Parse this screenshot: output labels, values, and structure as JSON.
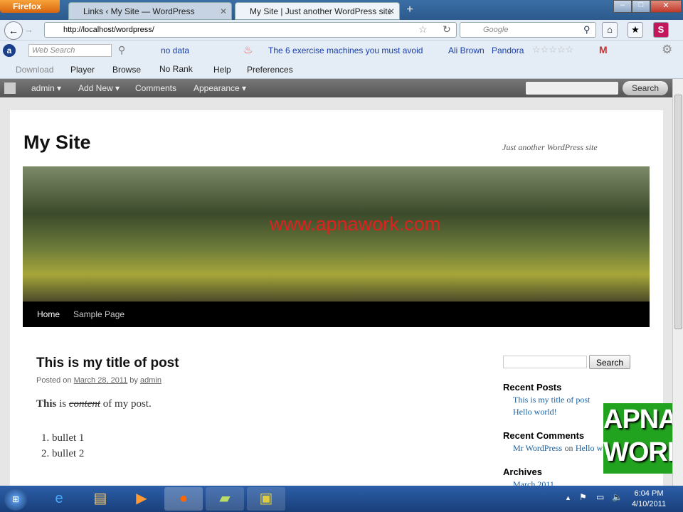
{
  "browser": {
    "menu": "Firefox",
    "tabs": [
      {
        "label": "Links ‹ My Site — WordPress"
      },
      {
        "label": "My Site | Just another WordPress site"
      }
    ],
    "new_tab": "+",
    "close": "✕",
    "url": "http://localhost/wordpress/",
    "search_placeholder": "Google"
  },
  "toolbar1": {
    "web_search": "Web Search",
    "no_data": "no data",
    "headline": "The 6 exercise machines you must avoid",
    "ali": "Ali Brown",
    "pandora": "Pandora"
  },
  "toolbar2": {
    "download": "Download",
    "player": "Player",
    "browse": "Browse",
    "no_rank": "No Rank",
    "help": "Help",
    "preferences": "Preferences"
  },
  "adminbar": {
    "admin": "admin ▾",
    "add_new": "Add New ▾",
    "comments": "Comments",
    "appearance": "Appearance ▾",
    "search": "Search"
  },
  "site": {
    "title": "My Site",
    "tagline": "Just another WordPress site",
    "watermark": "www.apnawork.com",
    "nav": [
      "Home",
      "Sample Page"
    ]
  },
  "post": {
    "title": "This is my title of post",
    "posted_on": "Posted on",
    "date": "March 28, 2011",
    "by": "by",
    "author": "admin",
    "body_bold": "This",
    "body_is": "is",
    "body_strike": "content",
    "body_rest": "of my post.",
    "bullets": [
      "bullet 1",
      "bullet 2"
    ]
  },
  "sidebar": {
    "search": "Search",
    "recent_posts": "Recent Posts",
    "posts": [
      "This is my title of post",
      "Hello world!"
    ],
    "recent_comments": "Recent Comments",
    "commenter": "Mr WordPress",
    "on": "on",
    "comment_post": "Hello w",
    "archives": "Archives",
    "archive": "March 2011"
  },
  "logo": {
    "line1": "APNA",
    "line2": "WORK"
  },
  "taskbar": {
    "time": "6:04 PM",
    "date": "4/10/2011"
  }
}
